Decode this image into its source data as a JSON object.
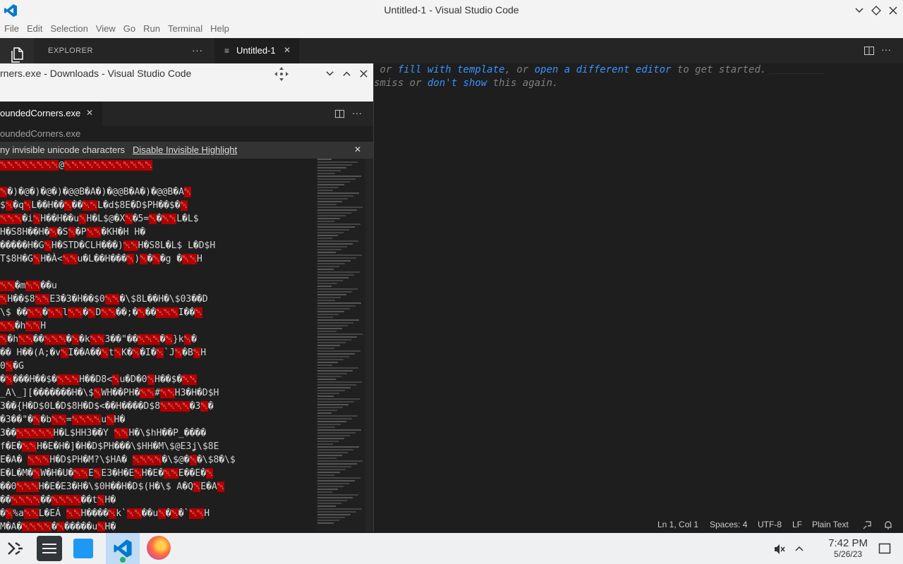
{
  "window": {
    "title": "Untitled-1 - Visual Studio Code"
  },
  "menu": [
    "File",
    "Edit",
    "Selection",
    "View",
    "Go",
    "Run",
    "Terminal",
    "Help"
  ],
  "sidebar": {
    "title": "EXPLORER",
    "more": "···"
  },
  "tabs": [
    {
      "label": "Untitled-1",
      "close": "✕"
    }
  ],
  "editor": {
    "line1": {
      "pre": " or ",
      "link1": "fill with template",
      "mid": ", or ",
      "link2": "open a different editor",
      "post": " to get started."
    },
    "line2": {
      "pre": "smiss or ",
      "link": "don't show",
      "post": " this again."
    }
  },
  "statusbar": {
    "position": "Ln 1, Col 1",
    "spaces": "Spaces: 4",
    "encoding": "UTF-8",
    "eol": "LF",
    "language": "Plain Text"
  },
  "secondWindow": {
    "title": "rners.exe - Downloads - Visual Studio Code",
    "tab": "oundedCorners.exe",
    "breadcrumb": "oundedCorners.exe",
    "banner": {
      "text": "ny invisible unicode characters",
      "action": "Disable Invisible Highlight"
    },
    "codeLines": [
      "␀␀␀␀␀␀␀␀@␀␀␀␀␀␀␀␀␀␀␀␀",
      "",
      "␀�)�@�)�@�)�@@B�A�)�@@B�A�)�@@B�A␀",
      "$␀�q␀L��H��␀��␀␀L�d$8E�D$PH��$�␀",
      "␀␀␀�i␀H��H��u␀H�L$@�X␀�5=␀�␀␀L�L$",
      "H�S8H��H�␀�S␀�P␀␀�KH�H H�",
      "�����H�G␀H�STD�CLH���)␀␀H�S8L�L$ L�D$H",
      "T$8H�G␀H�À<␀␀u�L��H���␀)␀�␀�g �␀␀H",
      "",
      "␀␀�m␀␀��u",
      "␀H��$8␀␀E3�3�H��$0␀␀�\\$8L��H�\\$03��D",
      "\\$ ��␀␀�␀␀l␀␀�␀D␀␀��;�␀��␀␀␀I��␀",
      "␀␀�h␀␀H",
      "␀�h␀␀��␀␀␀�␀�k␀␀3��\"��␀␀␀�␀}k␀�",
      "��  H��(A;�v␀I��A��␀t␀K�␀�I�␀`J␀�B␀H",
      "0␀�G",
      "�␀���H��$�␀␀␀H��D8<␀u�D�0␀H��$�␀␀",
      "_A\\_][�������H�\\$␀WH��PH�␀␀#␀␀H3�H�D$H",
      "3��{H�D$0L�D$8H�D$<��H����D$8␀␀␀␀�3̄␀�",
      "�3��\"�␀�b␀␀=␀␀␀␀u␀H�",
      "3��␀␀␀␀␀H�L$HH3��Y ␀␀H�\\$hH��P_����",
      "f�E�␀␀H�E�H�]�H�D$PH���\\$HH�M\\$@E3ʝ\\$8E",
      "E�A� ␀␀␀H�D$PH�M?\\$HA� ␀␀␀␀�\\$@�␀�\\$8�\\$",
      "E�L�M�␀W�H�U�␀␀E␀E3�H�E␀H�E�␀␀E��E�␀",
      "��0␀␀␀H�E�E3�H�\\$0H��H�D$(H�\\$ A�Q␀E�A␀",
      "��␀␀␀␀��␀␀␀␀��t␀H�",
      "�␀%a␀␀L�EÁ ␀␀H����␀k`␀␀��u␀�␀�`␀␀H",
      "M�A�␀␀␀␀�␀�����u␀H�"
    ]
  },
  "taskbar": {
    "time": "7:42 PM",
    "date": "5/26/23"
  },
  "colors": {
    "accent": "#0078d4",
    "redHighlight": "#b00000",
    "link": "#3794ff"
  },
  "icons": [
    "vscode-logo-icon",
    "explorer-icon",
    "chevron-down-icon",
    "restore-icon",
    "close-icon",
    "split-editor-icon",
    "more-icon",
    "move-icon",
    "maximize-icon",
    "feedback-icon",
    "bell-icon",
    "app-launcher-icon",
    "system-settings-icon",
    "store-icon",
    "vscode-task-icon",
    "firefox-icon",
    "volume-muted-icon",
    "chevron-up-icon",
    "show-desktop-icon"
  ]
}
